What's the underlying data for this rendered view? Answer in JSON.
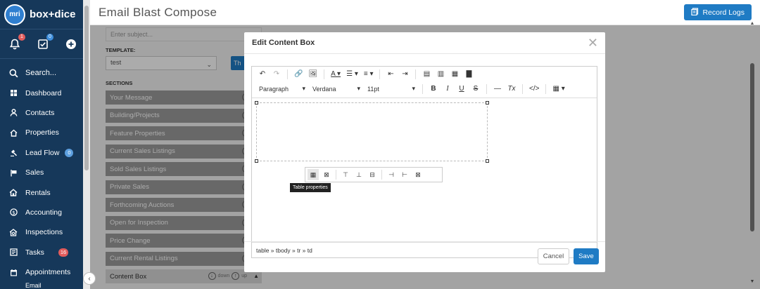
{
  "app": {
    "logo_text": "box+dice",
    "logo_initials": "mri"
  },
  "header_icons": [
    {
      "name": "bell-icon",
      "badge": "1",
      "badge_color": "#e25c5c"
    },
    {
      "name": "checklist-icon",
      "badge": "0",
      "badge_color": "#3f8fdc"
    },
    {
      "name": "plus-circle-icon"
    }
  ],
  "sidebar": {
    "search_label": "Search...",
    "items": [
      {
        "label": "Dashboard",
        "icon": "grid-icon"
      },
      {
        "label": "Contacts",
        "icon": "person-icon"
      },
      {
        "label": "Properties",
        "icon": "home-icon"
      },
      {
        "label": "Lead Flow",
        "icon": "gavel-icon",
        "badge": "0",
        "badge_color": "#5da0e0"
      },
      {
        "label": "Sales",
        "icon": "sign-icon"
      },
      {
        "label": "Rentals",
        "icon": "rental-home-icon"
      },
      {
        "label": "Accounting",
        "icon": "dollar-icon"
      },
      {
        "label": "Inspections",
        "icon": "inspection-icon"
      },
      {
        "label": "Tasks",
        "icon": "tasks-icon",
        "badge": "16",
        "badge_color": "#e25c5c"
      },
      {
        "label": "Appointments",
        "icon": "calendar-icon"
      },
      {
        "label": "Email",
        "icon": "email-icon"
      }
    ]
  },
  "header": {
    "title": "Email Blast Compose",
    "record_logs_label": "Record Logs"
  },
  "form": {
    "subject_placeholder": "Enter subject...",
    "template_label": "TEMPLATE:",
    "template_value": "test",
    "template_button": "Th",
    "sections_label": "SECTIONS",
    "sections": [
      "Your Message",
      "Building/Projects",
      "Feature Properties",
      "Current Sales Listings",
      "Sold Sales Listings",
      "Private Sales",
      "Forthcoming Auctions",
      "Open for Inspection",
      "Price Change",
      "Current Rental Listings"
    ],
    "expanded_section": {
      "label": "Content Box",
      "down": "down",
      "up": "up"
    }
  },
  "modal": {
    "title": "Edit Content Box",
    "format_value": "Paragraph",
    "font_value": "Verdana",
    "size_value": "11pt",
    "tooltip": "Table properties",
    "statusbar_path": "table » tbody » tr » td",
    "cancel_label": "Cancel",
    "save_label": "Save"
  },
  "colors": {
    "sidebar_bg": "#16385a",
    "accent": "#1f7bc4",
    "section_bg": "#9b9b9b"
  }
}
